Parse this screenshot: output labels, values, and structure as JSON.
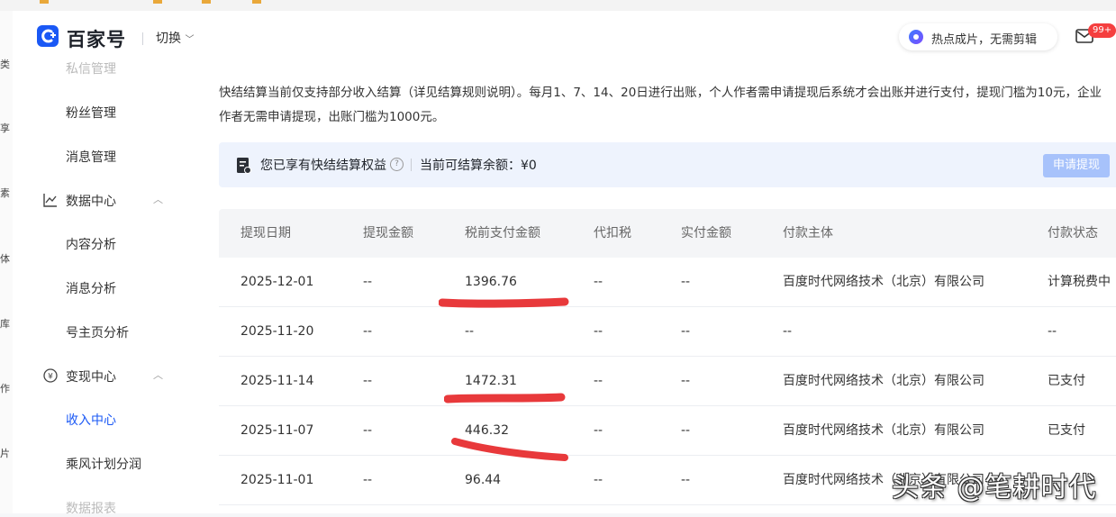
{
  "header": {
    "brand": "百家号",
    "switch_label": "切换",
    "hot_label": "热点成片，无需剪辑",
    "mail_badge": "99+",
    "brand_color": "#1a58f5"
  },
  "left_edge_chars": [
    "类",
    "享",
    "素",
    "体",
    "库",
    "作",
    "片"
  ],
  "sidebar": {
    "items_top": [
      {
        "label": "私信管理"
      },
      {
        "label": "粉丝管理"
      },
      {
        "label": "消息管理"
      }
    ],
    "group_data": {
      "label": "数据中心",
      "icon": "chart-line-icon"
    },
    "items_data": [
      {
        "label": "内容分析"
      },
      {
        "label": "消息分析"
      },
      {
        "label": "号主页分析"
      }
    ],
    "group_monetize": {
      "label": "变现中心",
      "icon": "yen-circle-icon"
    },
    "items_monetize": [
      {
        "label": "收入中心",
        "active": true
      },
      {
        "label": "乘风计划分润"
      },
      {
        "label": "数据报表"
      }
    ]
  },
  "notice": {
    "line1": "快结结算当前仅支持部分收入结算（详见结算规则说明）。每月1、7、14、20日进行出账，个人作者需申请提现后系统才会出账并进行支付，提现门槛为10元，企业",
    "line2": "作者无需申请提现，出账门槛为1000元。"
  },
  "banner": {
    "title": "您已享有快结结算权益",
    "help": "?",
    "balance": "当前可结算余额：¥0",
    "withdraw_label": "申请提现"
  },
  "table": {
    "headers": [
      "提现日期",
      "提现金额",
      "税前支付金额",
      "代扣税",
      "实付金额",
      "付款主体",
      "付款状态"
    ],
    "rows": [
      [
        "2025-12-01",
        "--",
        "1396.76",
        "--",
        "--",
        "百度时代网络技术（北京）有限公司",
        "计算税费中"
      ],
      [
        "2025-11-20",
        "--",
        "--",
        "--",
        "--",
        "--",
        "--"
      ],
      [
        "2025-11-14",
        "--",
        "1472.31",
        "--",
        "--",
        "百度时代网络技术（北京）有限公司",
        "已支付"
      ],
      [
        "2025-11-07",
        "--",
        "446.32",
        "--",
        "--",
        "百度时代网络技术（北京）有限公司",
        "已支付"
      ],
      [
        "2025-11-01",
        "--",
        "96.44",
        "--",
        "--",
        "百度时代网络技术（北京）有限公司",
        ""
      ]
    ]
  },
  "watermark": "头条 @笔耕时代",
  "colors": {
    "accent": "#1a58f5",
    "annotation_red": "#e8393b",
    "banner_bg": "#eef3fd"
  }
}
